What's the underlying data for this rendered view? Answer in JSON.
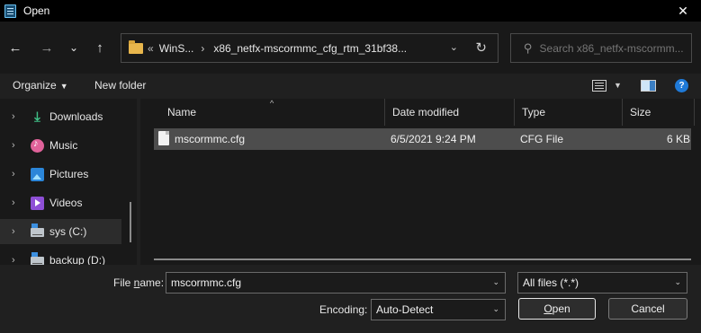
{
  "window": {
    "title": "Open",
    "close_glyph": "✕"
  },
  "nav": {
    "back": "←",
    "forward": "→",
    "recent": "⌄",
    "up": "↑",
    "address": {
      "prefix": "«",
      "crumbs": [
        "WinS...",
        "x86_netfx-mscormmc_cfg_rtm_31bf38..."
      ],
      "separator": "›",
      "dropdown": "⌄",
      "refresh": "↻"
    },
    "search_placeholder": "Search x86_netfx-mscormm..."
  },
  "toolbar": {
    "organize_label": "Organize",
    "new_folder_label": "New folder",
    "caret": "▼",
    "help_glyph": "?"
  },
  "sidebar": {
    "items": [
      {
        "label": "Downloads",
        "icon": "downloads-icon"
      },
      {
        "label": "Music",
        "icon": "music-icon"
      },
      {
        "label": "Pictures",
        "icon": "pictures-icon"
      },
      {
        "label": "Videos",
        "icon": "videos-icon"
      },
      {
        "label": "sys (C:)",
        "icon": "drive-icon",
        "selected": true
      },
      {
        "label": "backup (D:)",
        "icon": "drive-icon"
      }
    ],
    "chevron": "›"
  },
  "filelist": {
    "columns": [
      "Name",
      "Date modified",
      "Type",
      "Size"
    ],
    "sort_arrow": "^",
    "rows": [
      {
        "name": "mscormmc.cfg",
        "date": "6/5/2021 9:24 PM",
        "type": "CFG File",
        "size": "6 KB",
        "selected": true
      }
    ]
  },
  "bottom": {
    "filename_label_pre": "File ",
    "filename_label_u": "n",
    "filename_label_post": "ame:",
    "filename_value": "mscormmc.cfg",
    "filter_value": "All files  (*.*)",
    "encoding_label": "Encoding:",
    "encoding_value": "Auto-Detect",
    "open_label_u": "O",
    "open_label_rest": "pen",
    "cancel_label": "Cancel",
    "combo_arrow": "⌄"
  },
  "colors": {
    "titlebar": "#000000",
    "background": "#191919",
    "toolbar": "#202020",
    "selection": "#4d4d4d",
    "accent": "#1f7ad8"
  }
}
